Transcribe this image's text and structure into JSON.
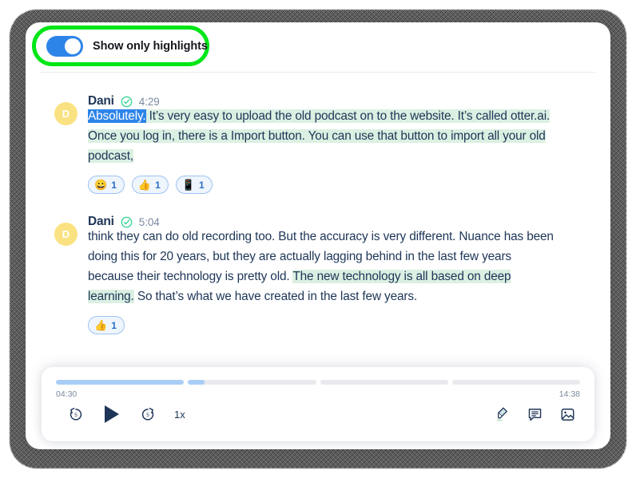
{
  "header": {
    "toggle": {
      "name": "show-only-highlights-toggle",
      "label": "Show only highlights",
      "state": "on",
      "track_color": "#2D84E8",
      "ring_color": "#00E617"
    }
  },
  "colors": {
    "highlight_green": "#DBF0E2",
    "selection_blue": "#2D84E8",
    "avatar_yellow": "#FAE282",
    "check_green": "#3DD598",
    "text_navy": "#1D3557",
    "seek_fill": "#A9CDF7",
    "seek_track": "#E8EAED"
  },
  "transcript": {
    "messages": [
      {
        "avatar_initial": "D",
        "speaker": "Dani",
        "verified_icon": "check-circle-icon",
        "time": "4:29",
        "segments": [
          {
            "text": "Absolutely.",
            "highlight": "blue"
          },
          {
            "text": " It’s very easy to upload the old podcast on to the website. It’s called otter.ai. Once you log in, there is a Import button. You can use that button to import all your old podcast,",
            "highlight": "green"
          }
        ],
        "reactions": [
          {
            "emoji": "😀",
            "icon_name": "grinning-face-emoji",
            "count": "1"
          },
          {
            "emoji": "👍",
            "icon_name": "thumbs-up-emoji",
            "count": "1"
          },
          {
            "emoji": "📱",
            "icon_name": "mobile-phone-emoji",
            "count": "1"
          }
        ]
      },
      {
        "avatar_initial": "D",
        "speaker": "Dani",
        "verified_icon": "check-circle-icon",
        "time": "5:04",
        "segments": [
          {
            "text": "think they can do old recording too. But the accuracy is very different. Nuance has been doing this for 20 years, but they are actually lagging behind in the last few years because their technology is pretty old. ",
            "highlight": "none"
          },
          {
            "text": "The new technology is all based on deep learning.",
            "highlight": "green"
          },
          {
            "text": " So that’s what we have created in the last few years.",
            "highlight": "none"
          }
        ],
        "reactions": [
          {
            "emoji": "👍",
            "icon_name": "thumbs-up-emoji",
            "count": "1"
          }
        ]
      }
    ]
  },
  "player": {
    "current_time": "04:30",
    "total_time": "14:38",
    "speed_label": "1x",
    "segments": [
      {
        "fill_percent": 100
      },
      {
        "fill_percent": 13
      },
      {
        "fill_percent": 0
      },
      {
        "fill_percent": 0
      }
    ],
    "controls": {
      "rewind": "rewind-5-seconds-button",
      "play": "play-button",
      "forward": "forward-5-seconds-button",
      "speed": "playback-speed-button"
    },
    "tools": [
      {
        "name": "highlighter-icon"
      },
      {
        "name": "comment-icon"
      },
      {
        "name": "image-icon"
      }
    ]
  }
}
